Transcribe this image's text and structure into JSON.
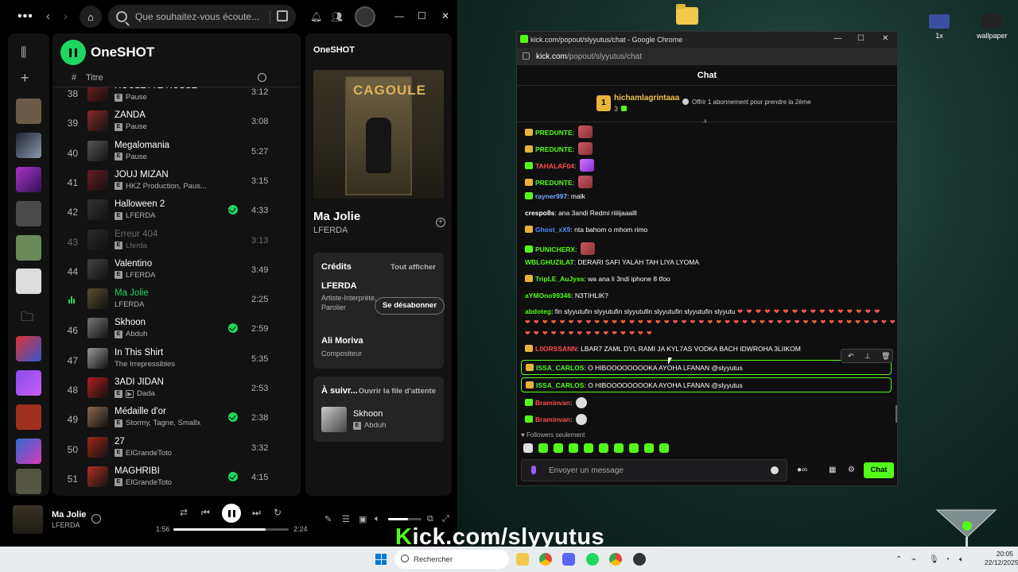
{
  "spotify": {
    "search_placeholder": "Que souhaitez-vous écoute...",
    "playlist_title": "OneSHOT",
    "col_num": "#",
    "col_title": "Titre",
    "tracks": [
      {
        "num": "38",
        "name": "ROULETTE RUSSE",
        "artist": "Pause",
        "dur": "3:12",
        "explicit": true,
        "saved": false,
        "state": "normal",
        "color": "#7a1f1f"
      },
      {
        "num": "39",
        "name": "ZANDA",
        "artist": "Pause",
        "dur": "3:08",
        "explicit": true,
        "saved": false,
        "state": "normal",
        "color": "#8a2a2a"
      },
      {
        "num": "40",
        "name": "Megalomania",
        "artist": "Pause",
        "dur": "5:27",
        "explicit": true,
        "saved": false,
        "state": "normal",
        "color": "#555"
      },
      {
        "num": "41",
        "name": "JOUJ MIZAN",
        "artist": "HKZ Production, Paus...",
        "dur": "3:15",
        "explicit": true,
        "saved": false,
        "state": "normal",
        "color": "#6a1a24"
      },
      {
        "num": "42",
        "name": "Halloween 2",
        "artist": "LFERDA",
        "dur": "4:33",
        "explicit": true,
        "saved": true,
        "state": "normal",
        "color": "#333"
      },
      {
        "num": "43",
        "name": "Erreur 404",
        "artist": "Lferda",
        "dur": "3:13",
        "explicit": true,
        "saved": false,
        "state": "dim",
        "color": "#2a2a2a"
      },
      {
        "num": "44",
        "name": "Valentino",
        "artist": "LFERDA",
        "dur": "3:49",
        "explicit": true,
        "saved": false,
        "state": "normal",
        "color": "#444"
      },
      {
        "num": "45",
        "name": "Ma Jolie",
        "artist": "LFERDA",
        "dur": "2:25",
        "explicit": false,
        "saved": false,
        "state": "playing",
        "color": "#5a4e30"
      },
      {
        "num": "46",
        "name": "Skhoon",
        "artist": "Abduh",
        "dur": "2:59",
        "explicit": true,
        "saved": true,
        "state": "normal",
        "color": "#777"
      },
      {
        "num": "47",
        "name": "In This Shirt",
        "artist": "The Irrepressibles",
        "dur": "5:35",
        "explicit": false,
        "saved": false,
        "state": "normal",
        "color": "#999"
      },
      {
        "num": "48",
        "name": "3ADI JIDAN",
        "artist": "Dada",
        "dur": "2:53",
        "explicit": true,
        "saved": false,
        "state": "normal",
        "color": "#b02020",
        "video": true
      },
      {
        "num": "49",
        "name": "Médaille d'or",
        "artist": "Stormy, Tagne, Smallx",
        "dur": "2:38",
        "explicit": true,
        "saved": true,
        "state": "normal",
        "color": "#8a6a50"
      },
      {
        "num": "50",
        "name": "27",
        "artist": "ElGrandeToto",
        "dur": "3:32",
        "explicit": true,
        "saved": false,
        "state": "normal",
        "color": "#a02818"
      },
      {
        "num": "51",
        "name": "MAGHRIBI",
        "artist": "ElGrandeToto",
        "dur": "4:15",
        "explicit": true,
        "saved": true,
        "state": "normal",
        "color": "#b03020"
      }
    ],
    "now_playing": {
      "panel_title": "OneSHOT",
      "cover_text": "CAGOULE",
      "song": "Ma Jolie",
      "artist": "LFERDA",
      "credits_title": "Crédits",
      "credits_link": "Tout afficher",
      "credit1_name": "LFERDA",
      "credit1_role": "Artiste-Interprète, Parolier",
      "unfollow": "Se désabonner",
      "credit2_name": "Ali Moriva",
      "credit2_role": "Compositeur",
      "next_title": "À suivr...",
      "queue_link": "Ouvrir la file d'attente",
      "next_song": "Skhoon",
      "next_artist": "Abduh"
    },
    "player": {
      "song": "Ma Jolie",
      "artist": "LFERDA",
      "elapsed": "1:56",
      "total": "2:24",
      "progress": 0.8,
      "volume": 0.6
    }
  },
  "chrome": {
    "title": "kick.com/popout/slyyutus/chat - Google Chrome",
    "url_host": "kick.com",
    "url_path": "/popout/slyyutus/chat"
  },
  "kick": {
    "header": "Chat",
    "sub_user": "hichamlagrintaaa",
    "sub_badge": "1",
    "sub_count": "3",
    "sub_offer": "Offrir 1 abonnement pour prendre la 2ème",
    "messages": [
      {
        "user": "PREDUNTE",
        "text": "",
        "badge": "gold",
        "color": "#53fc18",
        "emote": "r"
      },
      {
        "user": "PREDUNTE",
        "text": "",
        "badge": "gold",
        "color": "#53fc18",
        "emote": "r"
      },
      {
        "user": "TAHALAF04",
        "text": "",
        "badge": "green",
        "color": "#ff4d4d",
        "emote": "p"
      },
      {
        "user": "PREDUNTE",
        "text": "",
        "badge": "gold",
        "color": "#53fc18",
        "emote": "r"
      },
      {
        "user": "rayner997",
        "text": "malk",
        "badge": "green",
        "color": "#6ea8ff",
        "emote": ""
      },
      {
        "user": "crespo8s",
        "text": "ana 3andi Redmi riiiijaaalll",
        "badge": "",
        "color": "#ffffff",
        "emote": ""
      },
      {
        "user": "Ghost_xX9",
        "text": "nta bahom o mhom rimo",
        "badge": "gold",
        "color": "#4f8cff",
        "emote": ""
      },
      {
        "user": "PUNICHERX",
        "text": "",
        "badge": "green",
        "color": "#53fc18",
        "emote": "r"
      },
      {
        "user": "WBLGHUZILAT",
        "text": "DERARI SAFI YALAH TAH LIYA LYOMA",
        "badge": "",
        "color": "#53fc18",
        "emote": ""
      },
      {
        "user": "TripLE_AuJyss",
        "text": "wa ana li 3ndi iphone 8 tfoo",
        "badge": "gold",
        "color": "#53fc18",
        "emote": ""
      },
      {
        "user": "aYMOno99346",
        "text": "N3TIHLIK?",
        "badge": "",
        "color": "#53fc18",
        "emote": ""
      },
      {
        "user": "abdoteg",
        "text": "fin slyyutufin slyyutufin slyyutufin slyyutufin slyyutufin slyyutu",
        "badge": "",
        "color": "#53fc18",
        "emote": ""
      },
      {
        "user": "L0ORSSANN",
        "text": "LBAR7 ZAML DYL RAMI JA KYL7AS VODKA BACH IDWROHA 3LIIKOM",
        "badge": "gold",
        "color": "#ff4d4d",
        "emote": ""
      },
      {
        "user": "ISSA_CARLOS",
        "text": "O HIBOOOOOOOOKA AYOHA LFANAN @slyyutus",
        "badge": "gold",
        "color": "#53fc18",
        "emote": ""
      },
      {
        "user": "ISSA_CARLOS",
        "text": "O HIBOOOOOOOOKA AYOHA LFANAN @slyyutus",
        "badge": "gold",
        "color": "#53fc18",
        "emote": ""
      },
      {
        "user": "Braminvan",
        "text": "",
        "badge": "green",
        "color": "#ff4d4d",
        "emote": "w"
      },
      {
        "user": "Braminvan",
        "text": "",
        "badge": "green",
        "color": "#ff4d4d",
        "emote": "w"
      }
    ],
    "hearts_line1": "❤ ❤ ❤ ❤ ❤ ❤ ❤ ❤ ❤ ❤ ❤ ❤ ❤ ❤ ❤ ❤",
    "hearts_line2": "❤ ❤ ❤ ❤ ❤ ❤ ❤ ❤ ❤ ❤ ❤ ❤ ❤ ❤ ❤ ❤ ❤ ❤ ❤ ❤ ❤ ❤ ❤ ❤ ❤ ❤ ❤ ❤ ❤ ❤ ❤ ❤ ❤ ❤ ❤ ❤ ❤ ❤ ❤ ❤ ❤ ❤ ❤ ❤ ❤",
    "hearts_line3": "❤ ❤ ❤ ❤ ❤ ❤ ❤ ❤ ❤ ❤ ❤ ❤ ❤ ❤ ❤",
    "followers_only": "Followers seulement",
    "input_placeholder": "Envoyer un message",
    "chat_button": "Chat",
    "accent": "#53fc18"
  },
  "overlay": {
    "k": "K",
    "text": "ick.com/slyyutus"
  },
  "desktop": {
    "icon1": "1x",
    "icon2": "wallpaper"
  },
  "taskbar": {
    "search": "Rechercher",
    "time": "20:05",
    "date": "22/12/2025"
  }
}
